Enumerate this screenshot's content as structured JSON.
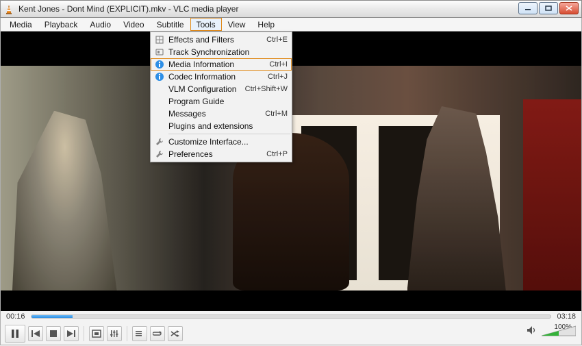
{
  "window_title": "Kent Jones - Dont Mind (EXPLICIT).mkv - VLC media player",
  "menus": [
    "Media",
    "Playback",
    "Audio",
    "Video",
    "Subtitle",
    "Tools",
    "View",
    "Help"
  ],
  "open_menu_index": 5,
  "tools_menu": [
    {
      "label": "Effects and Filters",
      "shortcut": "Ctrl+E",
      "icon": "effects"
    },
    {
      "label": "Track Synchronization",
      "shortcut": "",
      "icon": "sync"
    },
    {
      "label": "Media Information",
      "shortcut": "Ctrl+I",
      "icon": "info",
      "highlighted": true
    },
    {
      "label": "Codec Information",
      "shortcut": "Ctrl+J",
      "icon": "info"
    },
    {
      "label": "VLM Configuration",
      "shortcut": "Ctrl+Shift+W",
      "icon": ""
    },
    {
      "label": "Program Guide",
      "shortcut": "",
      "icon": ""
    },
    {
      "label": "Messages",
      "shortcut": "Ctrl+M",
      "icon": ""
    },
    {
      "label": "Plugins and extensions",
      "shortcut": "",
      "icon": ""
    },
    {
      "sep": true
    },
    {
      "label": "Customize Interface...",
      "shortcut": "",
      "icon": "wrench"
    },
    {
      "label": "Preferences",
      "shortcut": "Ctrl+P",
      "icon": "wrench"
    }
  ],
  "time_elapsed": "00:16",
  "time_total": "03:18",
  "progress_percent": 8,
  "volume_percent_label": "100%",
  "volume_fill_percent": 50,
  "controls": {
    "play": "Pause",
    "prev": "Previous",
    "stop": "Stop",
    "next": "Next",
    "fullscreen": "Fullscreen",
    "ext": "Extended settings",
    "playlist": "Playlist",
    "loop": "Loop",
    "shuffle": "Shuffle"
  }
}
